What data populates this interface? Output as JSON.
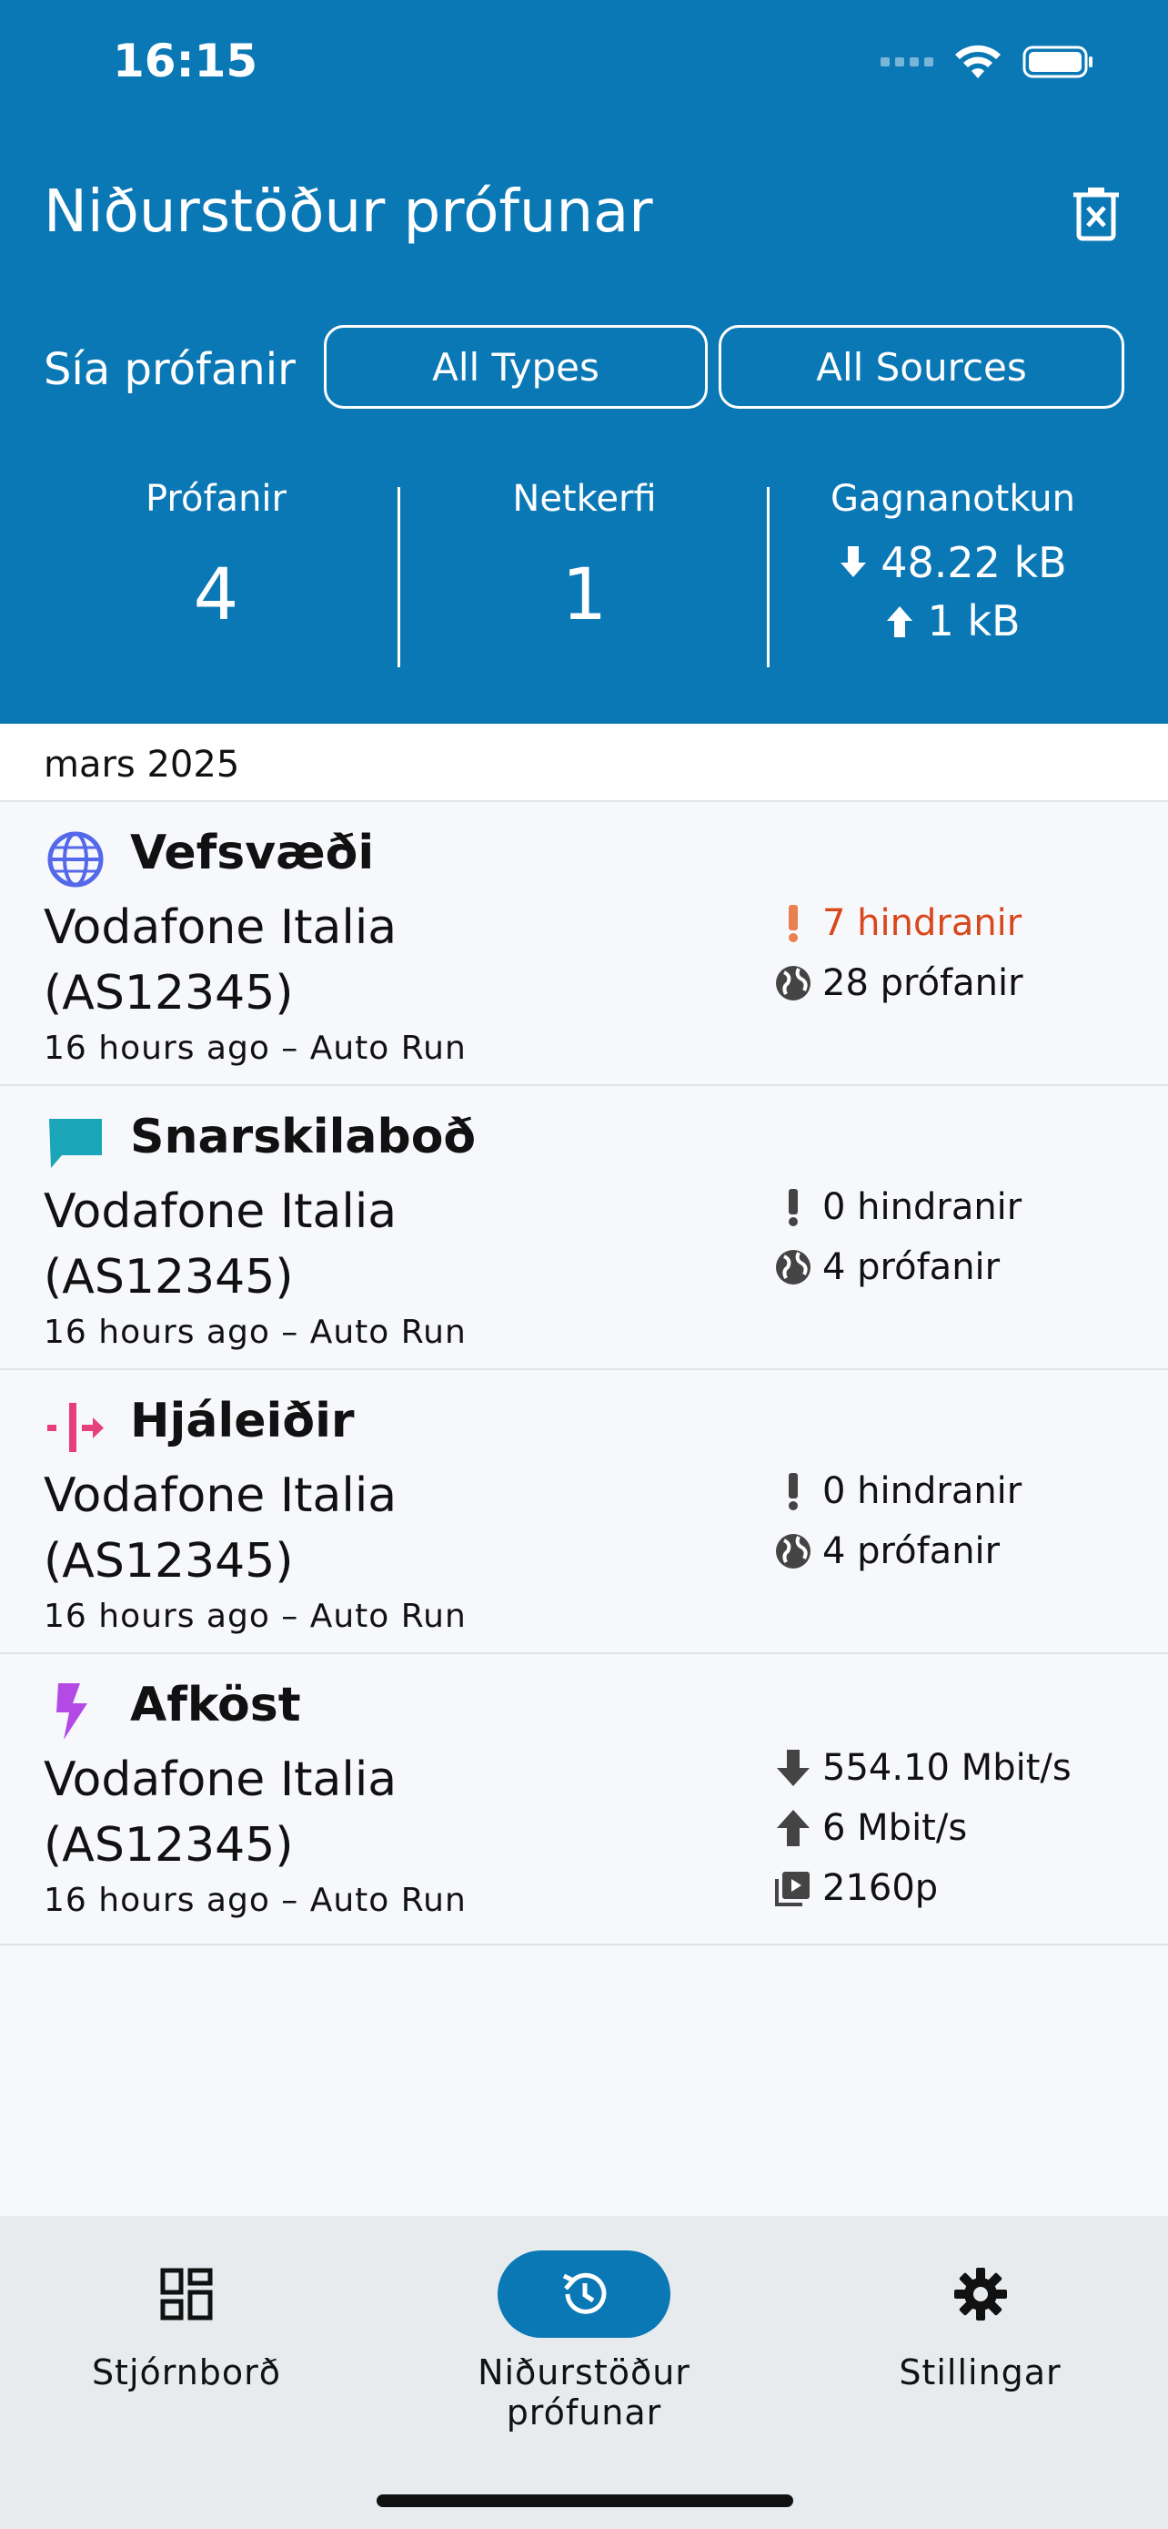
{
  "status": {
    "time": "16:15"
  },
  "header": {
    "title": "Niðurstöður prófunar",
    "filter_label": "Sía prófanir",
    "filter_types": "All Types",
    "filter_sources": "All Sources"
  },
  "stats": {
    "tests_label": "Prófanir",
    "tests_value": "4",
    "networks_label": "Netkerfi",
    "networks_value": "1",
    "data_label": "Gagnanotkun",
    "download": "48.22 kB",
    "upload": "1 kB"
  },
  "month": "mars 2025",
  "cards": [
    {
      "name": "Vefsvæði",
      "network": "Vodafone Italia (AS12345)",
      "meta": "16 hours ago – Auto Run",
      "line1": "7 hindranir",
      "line2": "28 prófanir",
      "color": "#5468ea"
    },
    {
      "name": "Snarskilaboð",
      "network": "Vodafone Italia (AS12345)",
      "meta": "16 hours ago – Auto Run",
      "line1": "0 hindranir",
      "line2": "4 prófanir",
      "color": "#1aa6b8"
    },
    {
      "name": "Hjáleiðir",
      "network": "Vodafone Italia (AS12345)",
      "meta": "16 hours ago – Auto Run",
      "line1": "0 hindranir",
      "line2": "4 prófanir",
      "color": "#e6407a"
    },
    {
      "name": "Afköst",
      "network": "Vodafone Italia (AS12345)",
      "meta": "16 hours ago – Auto Run",
      "line1": "554.10 Mbit/s",
      "line2": "6 Mbit/s",
      "line3": "2160p",
      "color": "#b44ae6"
    }
  ],
  "nav": {
    "dashboard": "Stjórnborð",
    "results": "Niðurstöður prófunar",
    "settings": "Stillingar",
    "active_color": "#0b78b6"
  }
}
